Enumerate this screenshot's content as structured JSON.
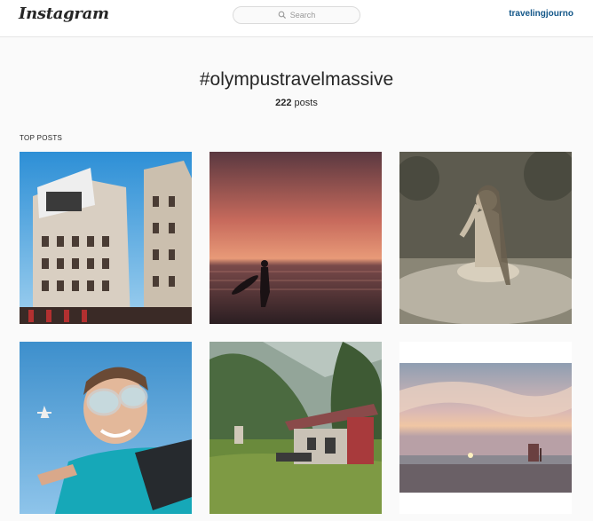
{
  "header": {
    "logo": "Instagram",
    "search_placeholder": "Search",
    "username": "travelingjourno"
  },
  "hashtag": {
    "title": "#olympustravelmassive",
    "post_count": "222",
    "post_count_suffix": " posts"
  },
  "top_posts_label": "TOP POSTS",
  "posts": [
    {
      "subject": "city-buildings"
    },
    {
      "subject": "sunset-surfer"
    },
    {
      "subject": "meditating-man"
    },
    {
      "subject": "skydiver-selfie"
    },
    {
      "subject": "red-hut-forest"
    },
    {
      "subject": "beach-sunset"
    }
  ]
}
